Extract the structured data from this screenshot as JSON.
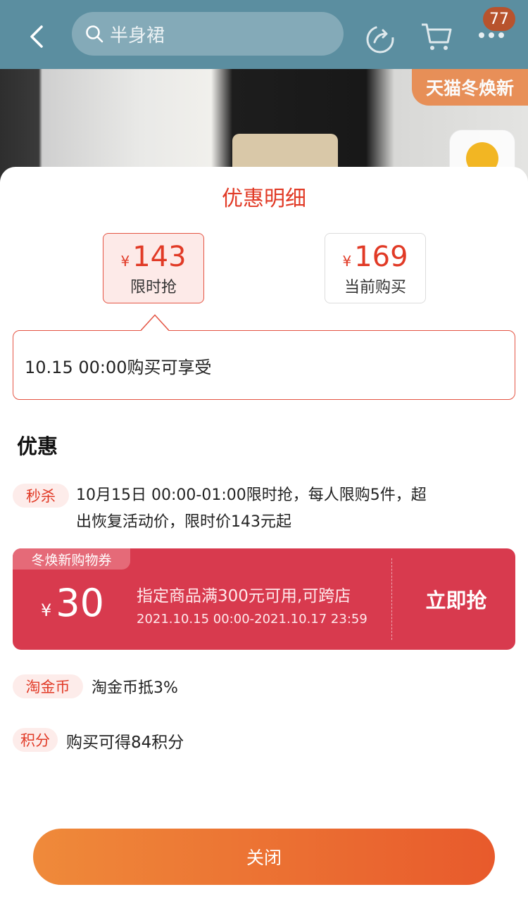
{
  "background_page": {
    "search_placeholder": "半身裙",
    "cart_badge": "77",
    "promo_tag": "天猫冬焕新"
  },
  "sheet": {
    "title": "优惠明细",
    "price_tabs": [
      {
        "currency": "¥",
        "price": "143",
        "label": "限时抢",
        "selected": true
      },
      {
        "currency": "¥",
        "price": "169",
        "label": "当前购买",
        "selected": false
      }
    ],
    "info_text": "10.15 00:00购买可享受",
    "section_title": "优惠",
    "flash_sale": {
      "tag": "秒杀",
      "line1": "10月15日 00:00-01:00限时抢，每人限购5件，超",
      "line2": "出恢复活动价，限时价143元起"
    },
    "coupon": {
      "tag": "冬焕新购物券",
      "currency": "¥",
      "amount": "30",
      "condition": "指定商品满300元可用,可跨店",
      "validity": "2021.10.15 00:00-2021.10.17 23:59",
      "button": "立即抢"
    },
    "gold_coin": {
      "tag": "淘金币",
      "text": "淘金币抵3%"
    },
    "points": {
      "tag": "积分",
      "text": "购买可得84积分"
    },
    "close_button": "关闭"
  },
  "colors": {
    "accent_red": "#e13a26",
    "coupon_red": "#d83a4e",
    "button_gradient_start": "#ef8a3a",
    "button_gradient_end": "#e85a2c",
    "header_bg": "#5b8ea0"
  }
}
